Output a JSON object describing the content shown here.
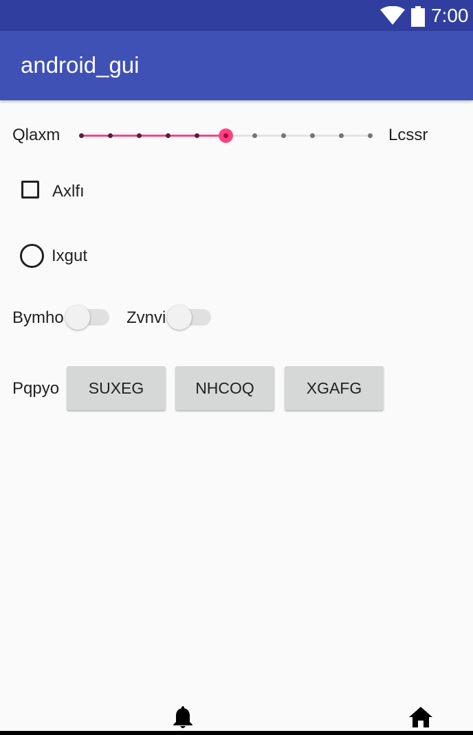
{
  "status_bar": {
    "time": "7:00",
    "wifi_icon": "wifi-icon",
    "battery_icon": "battery-icon",
    "color": "#303f9f"
  },
  "app_bar": {
    "title": "android_gui",
    "color": "#3f51b5"
  },
  "seekbar": {
    "left_label": "Qlaxm",
    "right_label": "Lcssr",
    "tick_count": 11,
    "selected_index": 5,
    "accent_color": "#ff4081"
  },
  "checkbox": {
    "label": "Axlfı",
    "checked": false
  },
  "radio": {
    "label": "Ixgut",
    "checked": false
  },
  "switches": [
    {
      "label": "Bymho",
      "on": false
    },
    {
      "label": "Zvnvi",
      "on": false
    }
  ],
  "button_row": {
    "label": "Pqpyo",
    "buttons": [
      "SUXEG",
      "NHCOQ",
      "XGAFG"
    ]
  },
  "bottom_nav": {
    "icons": [
      "bell-icon",
      "home-icon"
    ]
  }
}
